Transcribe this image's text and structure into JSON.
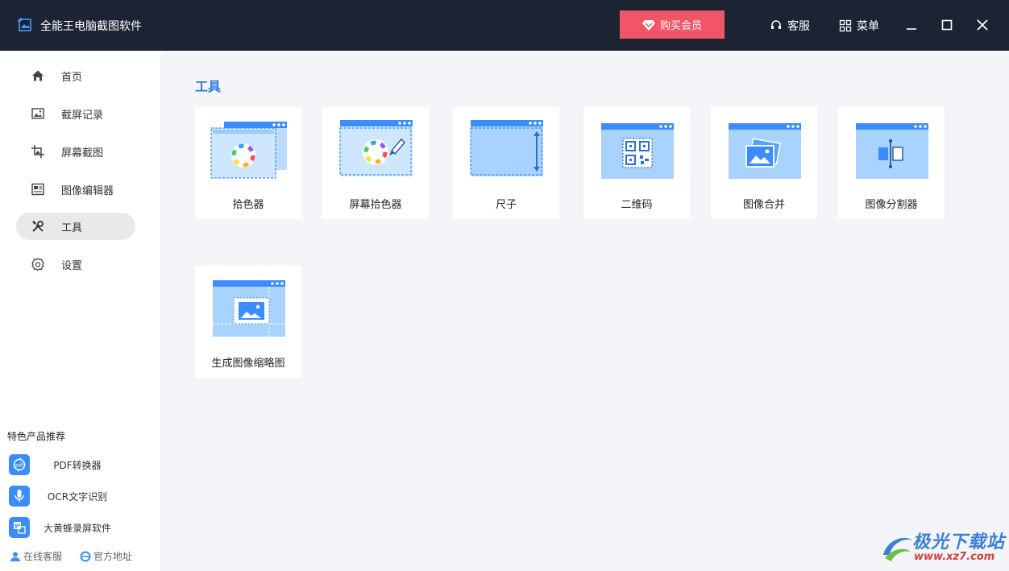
{
  "titlebar": {
    "app_title": "全能王电脑截图软件",
    "vip_label": "购买会员",
    "service_label": "客服",
    "menu_label": "菜单"
  },
  "sidebar": {
    "items": [
      {
        "label": "首页",
        "icon": "home-icon"
      },
      {
        "label": "截屏记录",
        "icon": "screenshot-history-icon"
      },
      {
        "label": "屏幕截图",
        "icon": "crop-icon"
      },
      {
        "label": "图像编辑器",
        "icon": "image-editor-icon"
      },
      {
        "label": "工具",
        "icon": "tools-icon",
        "active": true
      },
      {
        "label": "设置",
        "icon": "gear-icon"
      }
    ],
    "recommend_title": "特色产品推荐",
    "recommend": [
      {
        "label": "PDF转换器",
        "icon": "pdf-convert-icon"
      },
      {
        "label": "OCR文字识别",
        "icon": "microphone-icon"
      },
      {
        "label": "大黄蜂录屏软件",
        "icon": "word-icon"
      }
    ],
    "online_service": "在线客服",
    "official_site": "官方地址"
  },
  "main": {
    "section_title": "工具",
    "tools": [
      {
        "label": "拾色器",
        "icon": "color-picker-icon"
      },
      {
        "label": "屏幕拾色器",
        "icon": "screen-color-picker-icon"
      },
      {
        "label": "尺子",
        "icon": "ruler-icon"
      },
      {
        "label": "二维码",
        "icon": "qr-code-icon"
      },
      {
        "label": "图像合并",
        "icon": "image-merge-icon"
      },
      {
        "label": "图像分割器",
        "icon": "image-split-icon"
      },
      {
        "label": "生成图像缩略图",
        "icon": "thumbnail-icon"
      }
    ]
  },
  "watermark": {
    "name": "极光下载站",
    "url": "www.xz7.com"
  },
  "colors": {
    "titlebar_bg": "#1c2434",
    "vip_bg": "#f05667",
    "accent": "#2a7ae2",
    "icon_blue": "#3b8cff"
  }
}
